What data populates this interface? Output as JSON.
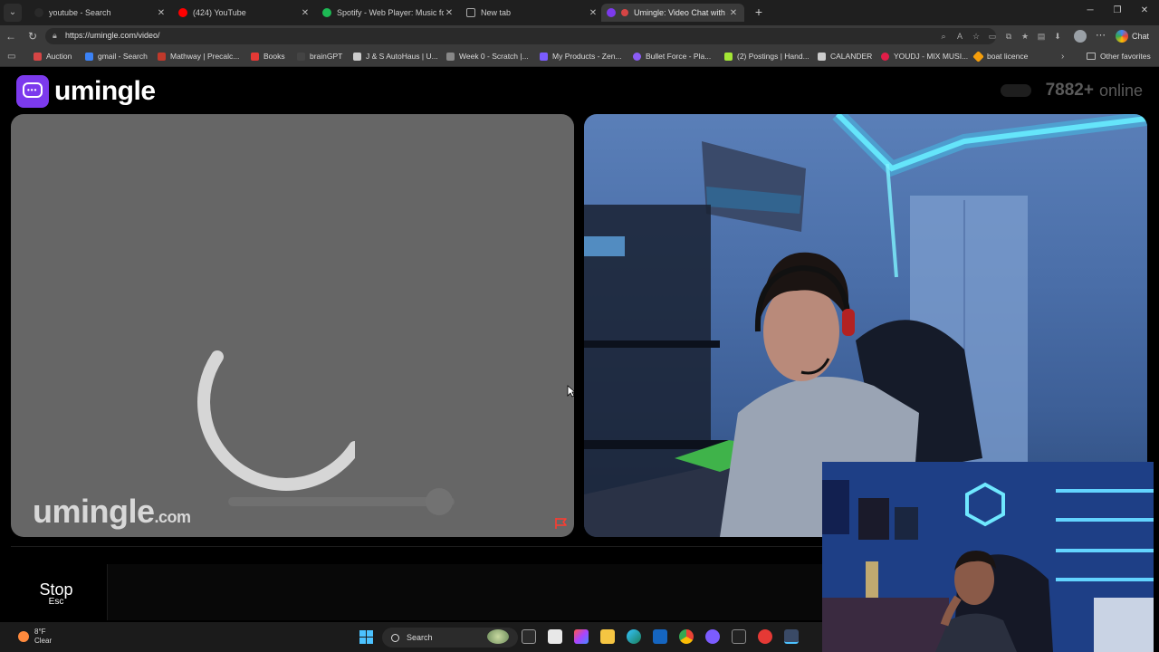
{
  "browser": {
    "tabs": [
      {
        "label": "youtube - Search",
        "favicon_color": "#2a2a2a",
        "active": false
      },
      {
        "label": "(424) YouTube",
        "favicon_color": "#ff0000",
        "active": false
      },
      {
        "label": "Spotify - Web Player: Music for ev",
        "favicon_color": "#1db954",
        "active": false
      },
      {
        "label": "New tab",
        "favicon_color": "#aaaaaa",
        "active": false
      },
      {
        "label": "Umingle: Video Chat with St",
        "favicon_color": "#7c3aed",
        "active": true
      }
    ],
    "new_tab": "+",
    "url": "https://umingle.com/video/",
    "chat_label": "Chat",
    "bookmarks": [
      {
        "label": "Auction",
        "color": "#d64545"
      },
      {
        "label": "gmail - Search",
        "color": "#3b82f6"
      },
      {
        "label": "Mathway | Precalc...",
        "color": "#c0392b"
      },
      {
        "label": "Books",
        "color": "#e53935"
      },
      {
        "label": "brainGPT",
        "color": "#444444"
      },
      {
        "label": "J & S AutoHaus | U...",
        "color": "#cccccc"
      },
      {
        "label": "Week 0 - Scratch |...",
        "color": "#888888"
      },
      {
        "label": "My Products - Zen...",
        "color": "#7b5cff"
      },
      {
        "label": "Bullet Force - Pla...",
        "color": "#8b5cf6"
      },
      {
        "label": "(2) Postings | Hand...",
        "color": "#a3e635"
      },
      {
        "label": "CALANDER",
        "color": "#cccccc"
      },
      {
        "label": "YOUDJ - MIX MUSI...",
        "color": "#e11d48"
      },
      {
        "label": "boat licence",
        "color": "#f59e0b"
      }
    ],
    "other_favorites": "Other favorites"
  },
  "page": {
    "logo_text": "umingle",
    "online_count": "7882+",
    "online_label": "online",
    "watermark": "umingle",
    "watermark_suffix": ".com",
    "volume_level": 0.93,
    "stop_label": "Stop",
    "stop_key": "Esc"
  },
  "taskbar": {
    "weather_temp": "8°F",
    "weather_desc": "Clear",
    "search_label": "Search"
  },
  "colors": {
    "brand": "#7c3aed",
    "report": "#ff3b30",
    "windows_accent": "#4cc2ff"
  }
}
